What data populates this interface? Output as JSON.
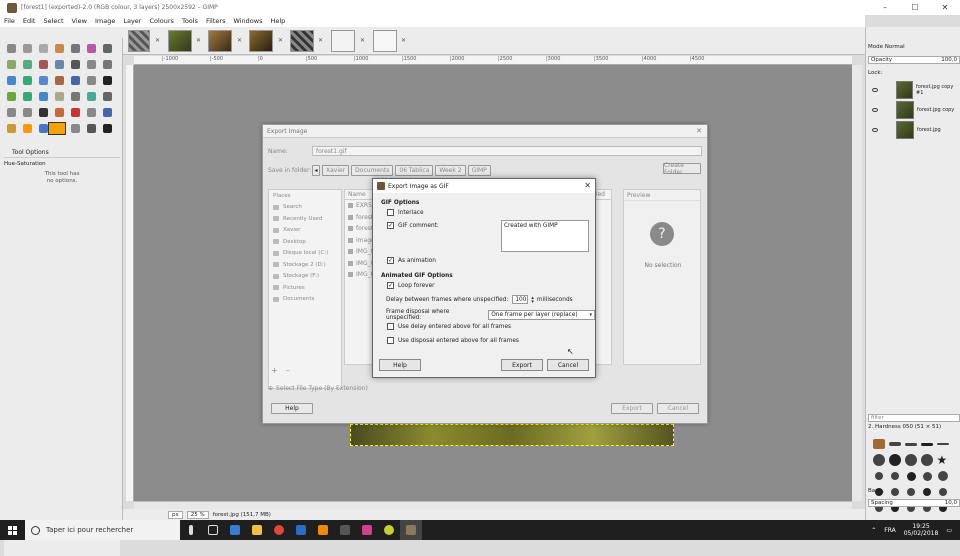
{
  "window": {
    "title": "[forest1] (exported)-2.0 (RGB colour, 3 layers) 2500x2592 – GIMP"
  },
  "window_controls": {
    "min": "–",
    "max": "☐",
    "close": "✕"
  },
  "menu": [
    "File",
    "Edit",
    "Select",
    "View",
    "Image",
    "Layer",
    "Colours",
    "Tools",
    "Filters",
    "Windows",
    "Help"
  ],
  "tool_options": {
    "header": "Tool Options",
    "tool": "Hue-Saturation",
    "note_1": "This tool has",
    "note_2": "no options."
  },
  "ruler": {
    "ticks": [
      "|-1000",
      "|-500",
      "|0",
      "|500",
      "|1000",
      "|1500",
      "|2000",
      "|2500",
      "|3000",
      "|3500",
      "|4000",
      "|4500"
    ]
  },
  "status": {
    "unit": "px",
    "zoom": "25 %",
    "file": "forest.jpg (151,7 MB)"
  },
  "layers_panel": {
    "mode_label": "Mode",
    "mode": "Normal",
    "opacity_label": "Opacity",
    "opacity": "100,0",
    "lock_label": "Lock:",
    "layers": [
      "forest.jpg copy #1",
      "forest.jpg copy",
      "forest.jpg"
    ]
  },
  "brushes_panel": {
    "filter": "filter",
    "brush": "2. Hardness 050 (51 × 51)",
    "category": "Basic.",
    "spacing_label": "Spacing",
    "spacing": "10,0"
  },
  "export_dialog": {
    "title": "Export Image",
    "name_label": "Name:",
    "name": "forest1.gif",
    "folder_label": "Save in folder:",
    "path": [
      "Xavier",
      "Documents",
      "06 Tablica",
      "Week 2",
      "GIMP"
    ],
    "create_folder": "Create Folder",
    "places_header": "Places",
    "places": [
      "Search",
      "Recently Used",
      "Xavier",
      "Desktop",
      "Disque local (C:)",
      "Stockage 2 (D:)",
      "Stockage (F:)",
      "Pictures",
      "Documents"
    ],
    "name_col": "Name",
    "modified_col": "Modified",
    "files": [
      "EXR5K",
      "forest",
      "forest1",
      "images",
      "IMG_0",
      "IMG_0",
      "IMG_0"
    ],
    "preview_header": "Preview",
    "no_selection": "No selection",
    "add": "+",
    "remove": "–",
    "file_type": "Select File Type (By Extension)",
    "help": "Help",
    "export": "Export",
    "cancel": "Cancel"
  },
  "gif_dialog": {
    "title": "Export Image as GIF",
    "gif_options": "GIF Options",
    "interlace": "Interlace",
    "gif_comment": "GIF comment:",
    "comment_text": "Created with GIMP",
    "as_animation": "As animation",
    "animated_options": "Animated GIF Options",
    "loop_forever": "Loop forever",
    "delay_label": "Delay between frames where unspecified:",
    "delay_value": "100",
    "delay_unit": "milliseconds",
    "disposal_label": "Frame disposal where unspecified:",
    "disposal_value": "One frame per layer (replace)",
    "use_delay": "Use delay entered above for all frames",
    "use_disposal": "Use disposal entered above for all frames",
    "help": "Help",
    "export": "Export",
    "cancel": "Cancel",
    "checks": {
      "interlace": false,
      "gif_comment": true,
      "as_animation": true,
      "loop_forever": true,
      "use_delay": false,
      "use_disposal": false
    }
  },
  "taskbar": {
    "search_placeholder": "Taper ici pour rechercher",
    "lang": "FRA",
    "time": "19:25",
    "date": "05/02/2018"
  },
  "colors": {
    "foreground": "#f5a300",
    "background": "#ffffff",
    "taskbar": "#1f1f1f"
  }
}
